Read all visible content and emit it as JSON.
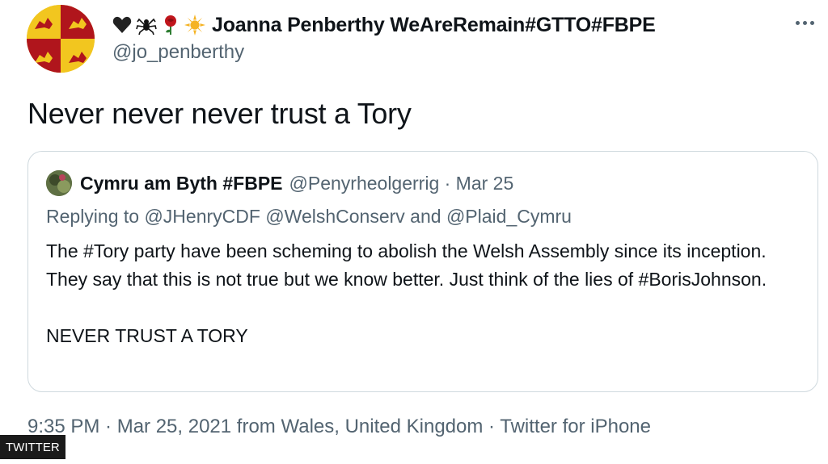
{
  "author": {
    "display_name": "Joanna Penberthy WeAreRemain#GTTO#FBPE",
    "handle": "@jo_penberthy",
    "emojis": [
      "black-heart-icon",
      "spider-icon",
      "rose-icon",
      "sun-icon"
    ]
  },
  "tweet": {
    "text": "Never never never trust a Tory"
  },
  "quoted": {
    "display_name": "Cymru am Byth #FBPE",
    "meta": "@Penyrheolgerrig · Mar 25",
    "replying_to": "Replying to @JHenryCDF @WelshConserv and @Plaid_Cymru",
    "body_para1": "The #Tory party have been scheming to abolish the Welsh Assembly since its inception. They say that this is not true but we know better. Just think of the lies of #BorisJohnson.",
    "body_para2": "NEVER TRUST A TORY"
  },
  "footer": {
    "meta": "9:35 PM · Mar 25, 2021 from Wales, United Kingdom · Twitter for iPhone"
  },
  "watermark": {
    "label": "TWITTER"
  },
  "colors": {
    "text": "#0f1419",
    "secondary": "#536471",
    "border": "#cfd9de",
    "crest_gold": "#f2c61f",
    "crest_red": "#b0151c"
  }
}
